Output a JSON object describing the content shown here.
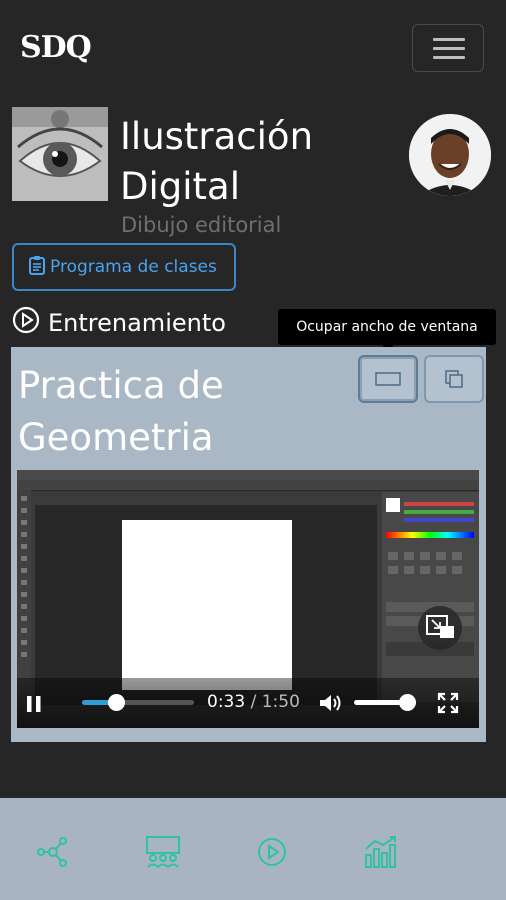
{
  "header": {
    "logo": "SDQ",
    "menu_icon": "hamburger-icon"
  },
  "course": {
    "title_line1": "Ilustración",
    "title_line2": "Digital",
    "subtitle": "Dibujo editorial",
    "program_button": "Programa de clases",
    "program_icon": "clipboard-icon"
  },
  "section": {
    "icon": "play-circle-icon",
    "label": "Entrenamiento"
  },
  "tooltip": "Ocupar ancho de ventana",
  "lesson": {
    "title_line1": "Practica de",
    "title_line2": "Geometria",
    "buttons": [
      {
        "name": "wide-view",
        "icon": "widescreen-icon"
      },
      {
        "name": "popout",
        "icon": "popout-icon"
      }
    ]
  },
  "player": {
    "current_time": "0:33",
    "separator": " / ",
    "total_time": "1:50",
    "progress_fraction": 0.3,
    "volume_fraction": 0.85
  },
  "bottom_nav": [
    {
      "name": "network",
      "icon": "network-icon"
    },
    {
      "name": "classroom",
      "icon": "classroom-icon"
    },
    {
      "name": "play",
      "icon": "play-circle-icon"
    },
    {
      "name": "stats",
      "icon": "stats-icon"
    }
  ],
  "colors": {
    "background": "#262626",
    "accent_blue": "#49a3ef",
    "card": "#a9b8c4",
    "nav_icon": "#2ec4a3",
    "bottom_bar": "#a8b4bf"
  }
}
